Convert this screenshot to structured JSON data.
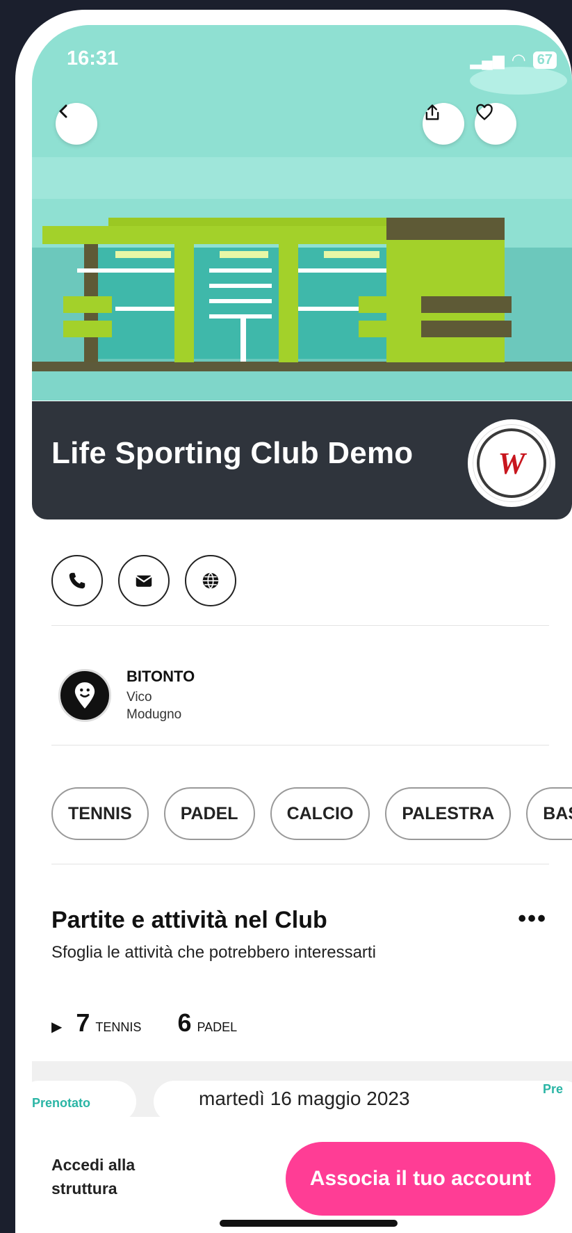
{
  "status_bar": {
    "time": "16:31",
    "battery": "67"
  },
  "header": {
    "back_icon": "chevron-left-icon",
    "share_icon": "share-icon",
    "favorite_icon": "heart-icon"
  },
  "club": {
    "name": "Life Sporting Club Demo",
    "logo_text": "W"
  },
  "contacts": [
    {
      "icon": "phone-icon"
    },
    {
      "icon": "mail-icon"
    },
    {
      "icon": "globe-icon"
    }
  ],
  "location": {
    "city": "BITONTO",
    "line1": "Vico",
    "line2": "Modugno"
  },
  "sports": [
    "TENNIS",
    "PADEL",
    "CALCIO",
    "PALESTRA",
    "BAS"
  ],
  "activities": {
    "title": "Partite e attività nel Club",
    "subtitle": "Sfoglia le attività che potrebbero interessarti",
    "more": "•••",
    "counts": [
      {
        "value": "7",
        "label": "TENNIS"
      },
      {
        "value": "6",
        "label": "PADEL"
      }
    ],
    "card_tag_left": "Prenotato",
    "card_date": "martedì 16 maggio 2023",
    "card_tag_right": "Pre"
  },
  "bottom": {
    "login_label": "Accedi alla struttura",
    "cta_label": "Associa il tuo account"
  },
  "colors": {
    "accent": "#ff3d95",
    "band": "#2f343c",
    "sky": "#8fe0d2"
  }
}
